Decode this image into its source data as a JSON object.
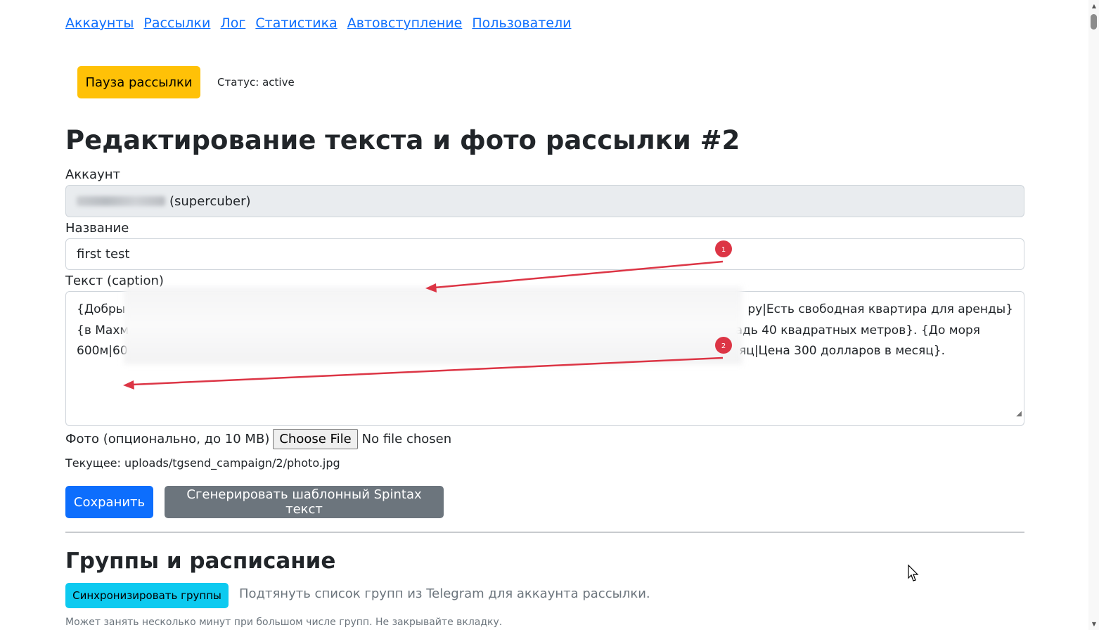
{
  "nav": {
    "links": [
      "Аккаунты",
      "Рассылки",
      "Лог",
      "Статистика",
      "Автовступление",
      "Пользователи"
    ]
  },
  "controls": {
    "pause_button": "Пауза рассылки",
    "status": "Статус: active"
  },
  "page_title": "Редактирование текста и фото рассылки #2",
  "form": {
    "account_label": "Аккаунт",
    "account_value": "(supercuber)",
    "name_label": "Название",
    "name_value": "first test",
    "text_label": "Текст (caption)",
    "text_lines": [
      "{Добры",
      "ру|Есть свободная квартира для аренды}",
      "{в Махм",
      "адь 40 квадратных метров}. {До моря",
      "600м|60",
      "яц|Цена 300 долларов в месяц}."
    ],
    "photo_label": "Фото (опционально, до 10 MB)",
    "choose_file": "Choose File",
    "no_file": "No file chosen",
    "current_photo": "Текущее: uploads/tgsend_campaign/2/photo.jpg",
    "save_button": "Сохранить",
    "spintax_button": "Сгенерировать шаблонный Spintax текст"
  },
  "groups": {
    "title": "Группы и расписание",
    "sync_button": "Синхронизировать группы",
    "sync_hint": "Подтянуть список групп из Telegram для аккаунта рассылки.",
    "sync_note": "Может занять несколько минут при большом числе групп. Не закрывайте вкладку."
  },
  "annotations": {
    "marker_1": "1",
    "marker_2": "2",
    "color": "#dc3545"
  },
  "colors": {
    "primary": "#0d6efd",
    "warning": "#ffc107",
    "secondary": "#6c757d",
    "info": "#0dcaf0"
  }
}
